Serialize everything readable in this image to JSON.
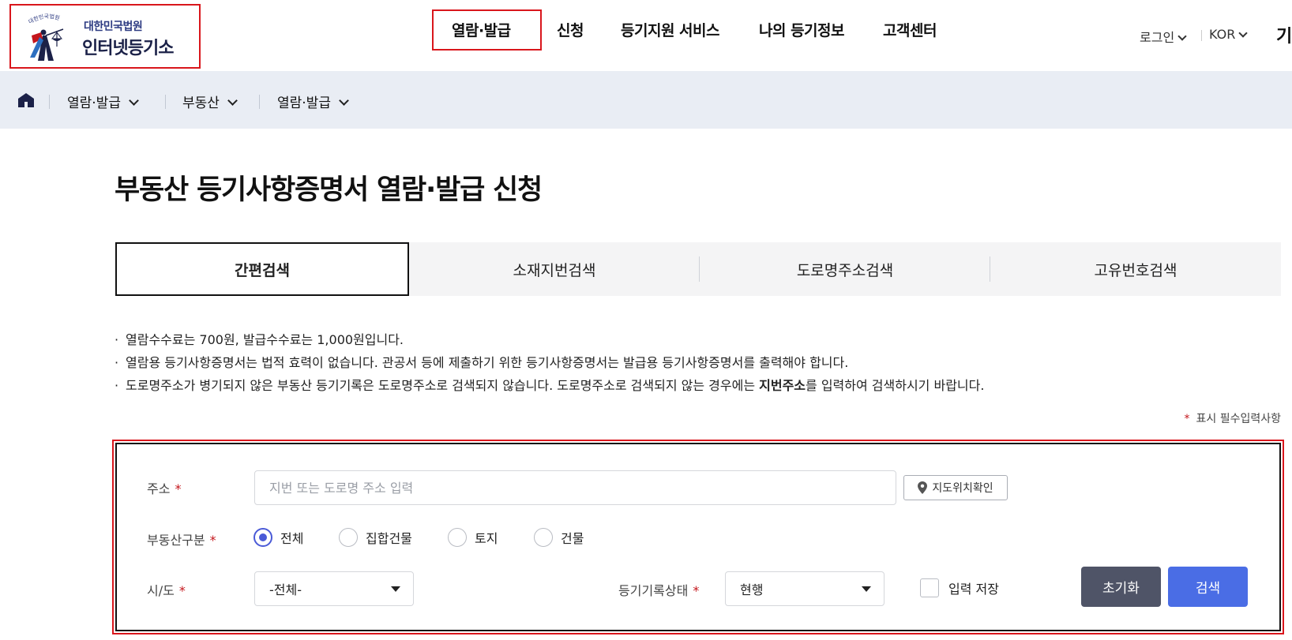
{
  "logo": {
    "sub_text": "대한민국법원",
    "main_text": "인터넷등기소",
    "arc_text": "대한민국법원"
  },
  "gnb": {
    "items": [
      "열람·발급",
      "신청",
      "등기지원 서비스",
      "나의 등기정보",
      "고객센터"
    ],
    "active": "열람·발급"
  },
  "util": {
    "login": "로그인",
    "language": "KOR",
    "overflow": "기"
  },
  "breadcrumb": {
    "items": [
      "열람·발급",
      "부동산",
      "열람·발급"
    ]
  },
  "page": {
    "title": "부동산 등기사항증명서 열람·발급 신청"
  },
  "tabs": {
    "items": [
      "간편검색",
      "소재지번검색",
      "도로명주소검색",
      "고유번호검색"
    ],
    "active": "간편검색"
  },
  "notices": {
    "line1": "열람수수료는  700원, 발급수수료는  1,000원입니다.",
    "line2": "열람용 등기사항증명서는 법적 효력이 없습니다. 관공서 등에 제출하기 위한 등기사항증명서는 발급용 등기사항증명서를 출력해야 합니다.",
    "line3_before": "도로명주소가 병기되지 않은 부동산 등기기록은 도로명주소로 검색되지 않습니다. 도로명주소로 검색되지 않는 경우에는 ",
    "line3_bold": "지번주소",
    "line3_after": "를 입력하여 검색하시기 바랍니다."
  },
  "required_note": {
    "star": "*",
    "text": "표시 필수입력사항"
  },
  "form": {
    "address": {
      "label": "주소",
      "placeholder": "지번 또는 도로명 주소 입력",
      "value": ""
    },
    "map_button": "지도위치확인",
    "property_type": {
      "label": "부동산구분",
      "options": [
        "전체",
        "집합건물",
        "토지",
        "건물"
      ],
      "selected": "전체"
    },
    "sido": {
      "label": "시/도",
      "value": "-전체-"
    },
    "record_status": {
      "label": "등기기록상태",
      "value": "현행"
    },
    "save_input": {
      "label": "입력 저장",
      "checked": false
    },
    "reset_button": "초기화",
    "search_button": "검색",
    "required_mark": "*"
  },
  "colors": {
    "highlight_red": "#d9161c",
    "required_red": "#c4161c",
    "radio_accent": "#4a5ad7",
    "search_button": "#4a6de5",
    "reset_button": "#4f5467",
    "breadcrumb_bg": "#e9edf4"
  }
}
